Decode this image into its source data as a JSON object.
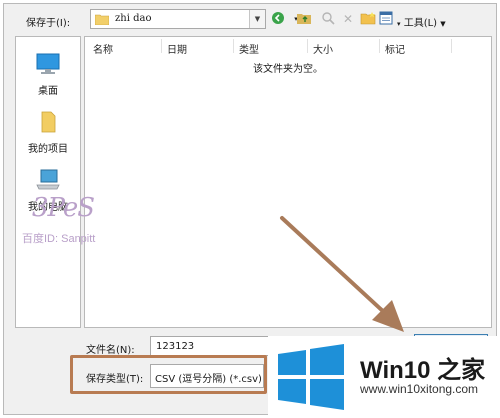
{
  "toolbar": {
    "save_in_label": "保存于(I):",
    "location_value": "zhi dao",
    "tools_label": "工具(L)"
  },
  "places": [
    {
      "label": "桌面",
      "icon": "desktop-icon"
    },
    {
      "label": "我的项目",
      "icon": "my-documents-icon"
    },
    {
      "label": "我的电脑",
      "icon": "my-computer-icon"
    }
  ],
  "filelist": {
    "columns": [
      "名称",
      "日期",
      "类型",
      "大小",
      "标记"
    ],
    "empty_message": "该文件夹为空。"
  },
  "form": {
    "filename_label": "文件名(N):",
    "filename_value": "123123",
    "filetype_label": "保存类型(T):",
    "filetype_value": "CSV (逗号分隔) (*.csv)"
  },
  "watermarks": {
    "baidu_id": "百度ID: Sanpitt",
    "logo_letters": "3PeS",
    "win_title": "Win10 之家",
    "win_url": "www.win10xitong.com"
  },
  "colors": {
    "annotation": "#b87b52",
    "win_blue": "#1e90d8"
  }
}
